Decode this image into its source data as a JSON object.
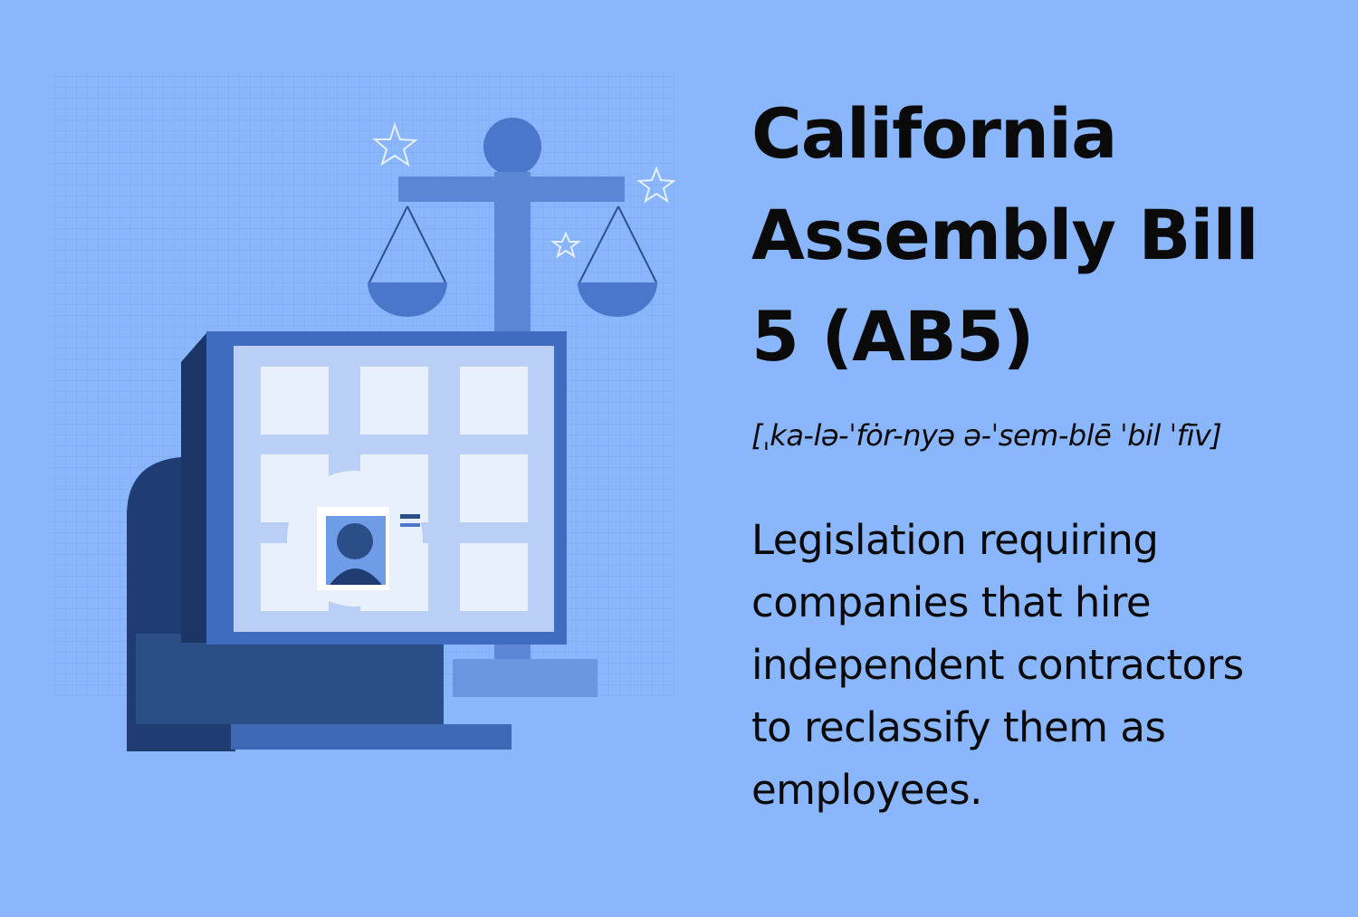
{
  "title": {
    "lines": [
      "California",
      "Assembly Bill",
      "5 (AB5)"
    ]
  },
  "pronunciation": "[ˌka-lə-ˈfȯr-nyə ə-ˈsem-blē ˈbil ˈfīv]",
  "definition": {
    "lines": [
      "Legislation requiring",
      "companies that hire",
      "independent contractors",
      "to reclassify them as",
      "employees."
    ]
  },
  "colors": {
    "background": "#8ab6fc",
    "text": "#0a0a0a",
    "dark": "#1f3d73",
    "mid": "#4a77c9",
    "light": "#dde8fb"
  }
}
